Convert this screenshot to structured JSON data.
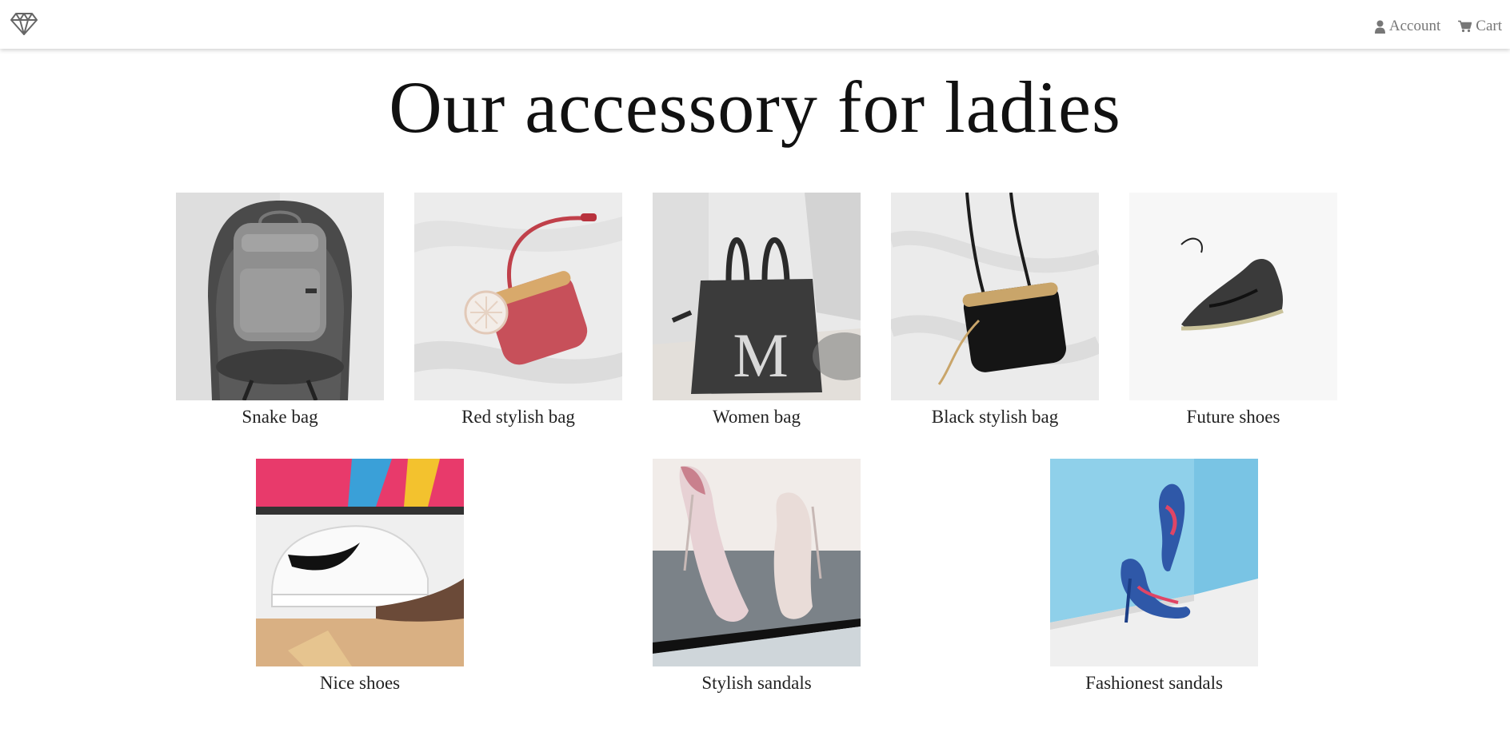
{
  "header": {
    "logo_icon": "diamond-icon",
    "nav": [
      {
        "label": "Account",
        "icon": "user-icon"
      },
      {
        "label": "Cart",
        "icon": "cart-icon"
      }
    ]
  },
  "page": {
    "title": "Our accessory for ladies"
  },
  "products": [
    {
      "name": "Snake bag"
    },
    {
      "name": "Red stylish bag"
    },
    {
      "name": "Women bag"
    },
    {
      "name": "Black stylish bag"
    },
    {
      "name": "Future shoes"
    },
    {
      "name": "Nice shoes"
    },
    {
      "name": "Stylish sandals"
    },
    {
      "name": "Fashionest sandals"
    }
  ]
}
